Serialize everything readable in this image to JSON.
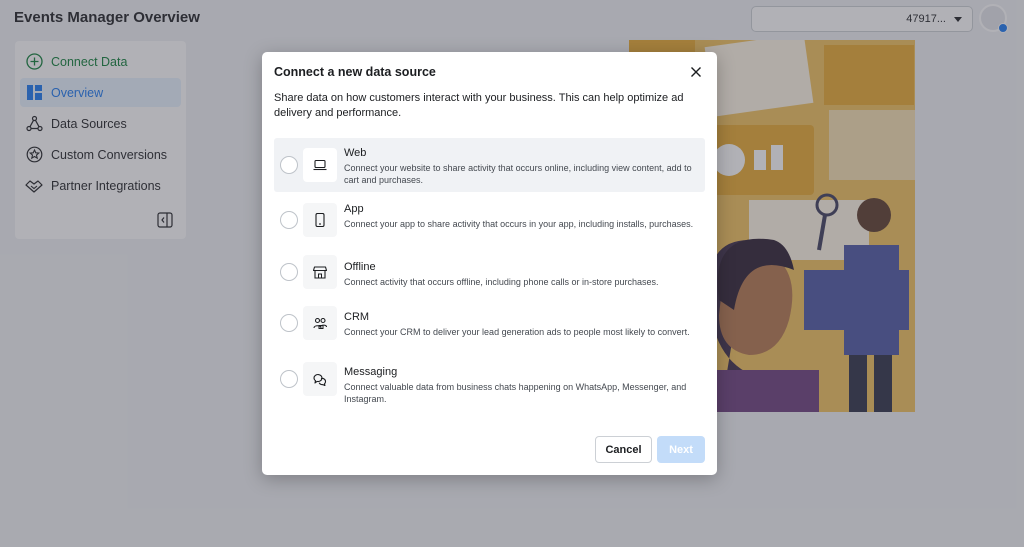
{
  "header": {
    "title": "Events Manager Overview",
    "account_id": "47917..."
  },
  "sidebar": {
    "items": [
      {
        "label": "Connect Data",
        "icon": "plus-circle-icon"
      },
      {
        "label": "Overview",
        "icon": "grid-icon"
      },
      {
        "label": "Data Sources",
        "icon": "nodes-icon"
      },
      {
        "label": "Custom Conversions",
        "icon": "star-badge-icon"
      },
      {
        "label": "Partner Integrations",
        "icon": "handshake-icon"
      }
    ],
    "active_index": 1
  },
  "modal": {
    "title": "Connect a new data source",
    "description": "Share data on how customers interact with your business. This can help optimize ad delivery and performance.",
    "options": [
      {
        "name": "Web",
        "description": "Connect your website to share activity that occurs online, including view content, add to cart and purchases.",
        "icon": "laptop-icon"
      },
      {
        "name": "App",
        "description": "Connect your app to share activity that occurs in your app, including installs, purchases.",
        "icon": "phone-icon"
      },
      {
        "name": "Offline",
        "description": "Connect activity that occurs offline, including phone calls or in-store purchases.",
        "icon": "store-icon"
      },
      {
        "name": "CRM",
        "description": "Connect your CRM to deliver your lead generation ads to people most likely to convert.",
        "icon": "people-icon"
      },
      {
        "name": "Messaging",
        "description": "Connect valuable data from business chats happening on WhatsApp, Messenger, and Instagram.",
        "icon": "chat-icon"
      }
    ],
    "highlighted_index": 0,
    "cancel_label": "Cancel",
    "next_label": "Next"
  },
  "colors": {
    "accent": "#1877f2",
    "connect_green": "#0a7d34",
    "next_disabled": "#c3dcf9"
  }
}
